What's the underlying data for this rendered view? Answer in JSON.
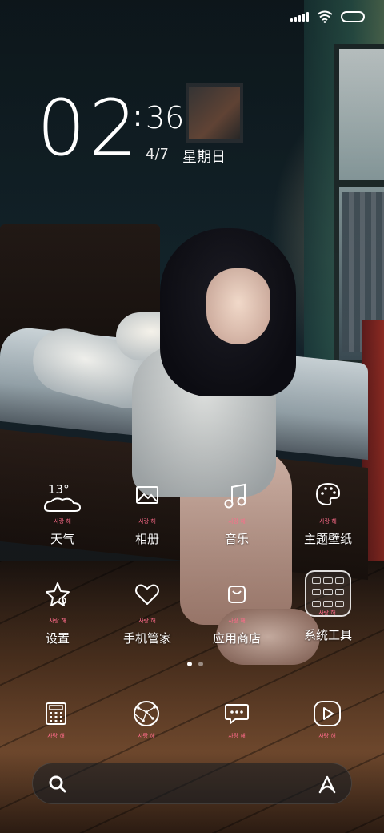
{
  "status_bar": {
    "signal_icon": "signal-icon",
    "wifi_icon": "wifi-icon",
    "battery_icon": "battery-icon"
  },
  "clock": {
    "hours": "02",
    "separator": ":",
    "minutes": "36",
    "date": "4/7",
    "weekday": "星期日"
  },
  "apps": [
    {
      "id": "weather",
      "label": "天气",
      "icon": "weather-cloud-icon",
      "temp": "13°",
      "sub": "사랑 해"
    },
    {
      "id": "gallery",
      "label": "相册",
      "icon": "gallery-icon",
      "sub": "사랑 해"
    },
    {
      "id": "music",
      "label": "音乐",
      "icon": "music-note-icon",
      "sub": "사랑 해"
    },
    {
      "id": "themes",
      "label": "主题壁纸",
      "icon": "palette-icon",
      "sub": "사랑 해"
    },
    {
      "id": "settings",
      "label": "设置",
      "icon": "star-gear-icon",
      "sub": "사랑 해"
    },
    {
      "id": "security",
      "label": "手机管家",
      "icon": "heart-icon",
      "sub": "사랑 해"
    },
    {
      "id": "app_store",
      "label": "应用商店",
      "icon": "shopping-bag-icon",
      "sub": "사랑 해"
    },
    {
      "id": "system_tools",
      "label": "系统工具",
      "icon": "folder-icon",
      "sub": "사랑 해"
    }
  ],
  "dock": [
    {
      "id": "phone",
      "icon": "phone-icon",
      "sub": "사랑 해"
    },
    {
      "id": "browser",
      "icon": "browser-constellation-icon",
      "sub": "사랑 해"
    },
    {
      "id": "messages",
      "icon": "message-icon",
      "sub": "사랑 해"
    },
    {
      "id": "video",
      "icon": "video-play-icon",
      "sub": "사랑 해"
    }
  ],
  "search_bar": {
    "search_icon": "search-icon",
    "assistant_icon": "assistant-icon"
  },
  "page_indicator": {
    "pages": 2,
    "current": 1
  },
  "colors": {
    "sub_label": "#ff6b8a",
    "text": "#ffffff",
    "indicator": "#7fb3d3"
  }
}
